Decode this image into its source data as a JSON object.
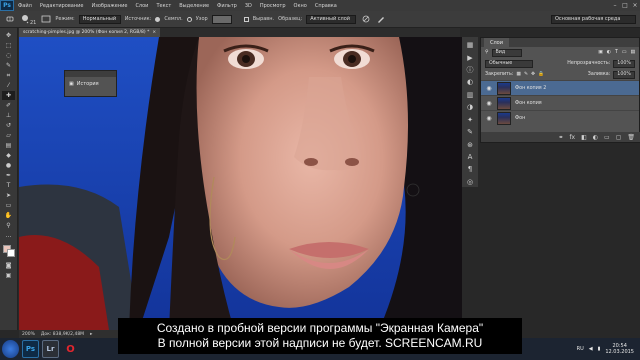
{
  "app": {
    "logo": "Ps"
  },
  "menu": {
    "items": [
      "Файл",
      "Редактирование",
      "Изображение",
      "Слои",
      "Текст",
      "Выделение",
      "Фильтр",
      "3D",
      "Просмотр",
      "Окно",
      "Справка"
    ],
    "controls": [
      "–",
      "□",
      "×"
    ]
  },
  "options": {
    "brush_size": "21",
    "mode_label": "Режим:",
    "mode_value": "Нормальный",
    "source_label": "Источник:",
    "source_opt1": "Семпл.",
    "source_opt2": "Узор",
    "align_label": "Выравн.",
    "sample_label": "Образец:",
    "sample_value": "Активный слой",
    "workspace": "Основная рабочая среда"
  },
  "document": {
    "tab_title": "scratching-pimples.jpg @ 200% (Фон копия 2, RGB/8) *",
    "close": "×",
    "zoom": "200%",
    "doc_info": "Док: 838,9K/2,48M",
    "status_arrow": "▸"
  },
  "history_panel": {
    "title": "История"
  },
  "layers_panel": {
    "tabs": [
      "Слои"
    ],
    "filter_label": "Вид",
    "blend_mode": "Обычные",
    "opacity_label": "Непрозрачность:",
    "opacity_value": "100%",
    "lock_label": "Закрепить:",
    "fill_label": "Заливка:",
    "fill_value": "100%",
    "layers": [
      {
        "name": "Фон копия 2",
        "selected": true
      },
      {
        "name": "Фон копия",
        "selected": false
      },
      {
        "name": "Фон",
        "selected": false
      }
    ]
  },
  "taskbar": {
    "apps": [
      "Ps",
      "Lr",
      "O"
    ],
    "time": "20:54",
    "date": "12.03.2015",
    "lang": "RU"
  },
  "watermark": {
    "line1": "Создано в пробной версии программы \"Экранная Камера\"",
    "line2": "В полной версии этой надписи не будет. SCREENCAM.RU"
  },
  "colors": {
    "accent": "#4b6a92",
    "ps_blue": "#39a2e6",
    "canvas_blue": "#1b47b8"
  }
}
